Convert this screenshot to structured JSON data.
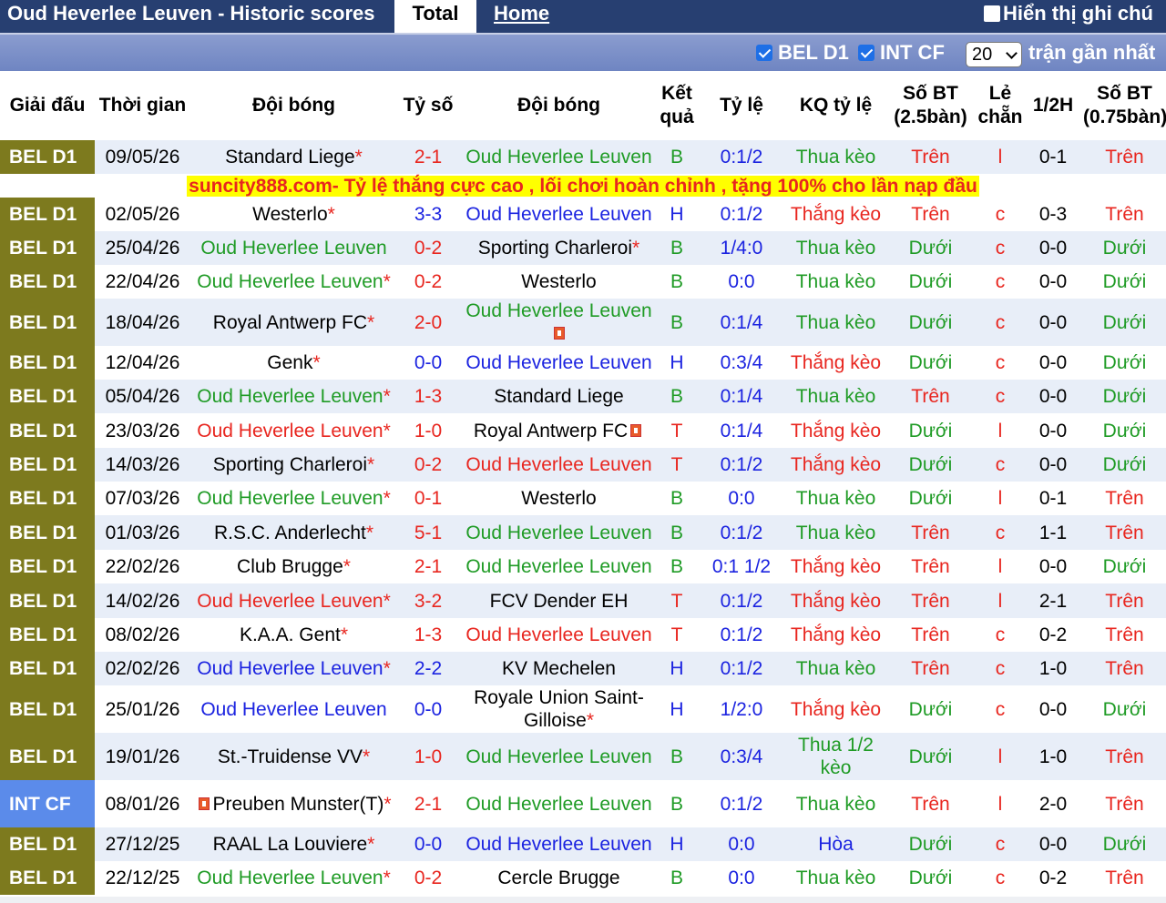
{
  "header": {
    "title": "Oud Heverlee Leuven - Historic scores",
    "tab_total": "Total",
    "tab_home": "Home",
    "notes_label": "Hiển thị ghi chú"
  },
  "filters": {
    "league1": "BEL D1",
    "league2": "INT CF",
    "count_value": "20",
    "count_suffix": "trận gần nhất"
  },
  "columns": [
    "Giải đấu",
    "Thời gian",
    "Đội bóng",
    "Tỷ số",
    "Đội bóng",
    "Kết quả",
    "Tỷ lệ",
    "KQ tỷ lệ",
    "Số BT (2.5bàn)",
    "Lẻ chẵn",
    "1/2H",
    "Số BT (0.75bàn)"
  ],
  "ad_text": "suncity888.com- Tỷ lệ thắng cực cao , lối chơi hoàn chỉnh , tặng 100% cho lần nạp đầu",
  "matches": [
    {
      "league": "BEL D1",
      "date": "09/05/26",
      "home": "Standard Liege",
      "home_star": "*",
      "score": "2-1",
      "away": "Oud Heverlee Leuven",
      "away_star": "",
      "result": "B",
      "odds": "0:1/2",
      "odds_result": "Thua kèo",
      "ou": "Trên",
      "oe": "l",
      "half": "0-1",
      "ou2": "Trên"
    },
    {
      "league": "BEL D1",
      "date": "02/05/26",
      "home": "Westerlo",
      "home_star": "*",
      "score": "3-3",
      "away": "Oud Heverlee Leuven",
      "away_star": "",
      "result": "H",
      "odds": "0:1/2",
      "odds_result": "Thắng kèo",
      "ou": "Trên",
      "oe": "c",
      "half": "0-3",
      "ou2": "Trên"
    },
    {
      "league": "BEL D1",
      "date": "25/04/26",
      "home": "Oud Heverlee Leuven",
      "home_star": "",
      "score": "0-2",
      "away": "Sporting Charleroi",
      "away_star": "*",
      "result": "B",
      "odds": "1/4:0",
      "odds_result": "Thua kèo",
      "ou": "Dưới",
      "oe": "c",
      "half": "0-0",
      "ou2": "Dưới"
    },
    {
      "league": "BEL D1",
      "date": "22/04/26",
      "home": "Oud Heverlee Leuven",
      "home_star": "*",
      "score": "0-2",
      "away": "Westerlo",
      "away_star": "",
      "result": "B",
      "odds": "0:0",
      "odds_result": "Thua kèo",
      "ou": "Dưới",
      "oe": "c",
      "half": "0-0",
      "ou2": "Dưới"
    },
    {
      "league": "BEL D1",
      "date": "18/04/26",
      "home": "Royal Antwerp FC",
      "home_star": "*",
      "score": "2-0",
      "away": "Oud Heverlee Leuven",
      "away_star": "",
      "result": "B",
      "odds": "0:1/4",
      "odds_result": "Thua kèo",
      "ou": "Dưới",
      "oe": "c",
      "half": "0-0",
      "ou2": "Dưới"
    },
    {
      "league": "BEL D1",
      "date": "12/04/26",
      "home": "Genk",
      "home_star": "*",
      "score": "0-0",
      "away": "Oud Heverlee Leuven",
      "away_star": "",
      "result": "H",
      "odds": "0:3/4",
      "odds_result": "Thắng kèo",
      "ou": "Dưới",
      "oe": "c",
      "half": "0-0",
      "ou2": "Dưới"
    },
    {
      "league": "BEL D1",
      "date": "05/04/26",
      "home": "Oud Heverlee Leuven",
      "home_star": "*",
      "score": "1-3",
      "away": "Standard Liege",
      "away_star": "",
      "result": "B",
      "odds": "0:1/4",
      "odds_result": "Thua kèo",
      "ou": "Trên",
      "oe": "c",
      "half": "0-0",
      "ou2": "Dưới"
    },
    {
      "league": "BEL D1",
      "date": "23/03/26",
      "home": "Oud Heverlee Leuven",
      "home_star": "*",
      "score": "1-0",
      "away": "Royal Antwerp FC",
      "away_star": "",
      "result": "T",
      "odds": "0:1/4",
      "odds_result": "Thắng kèo",
      "ou": "Dưới",
      "oe": "l",
      "half": "0-0",
      "ou2": "Dưới"
    },
    {
      "league": "BEL D1",
      "date": "14/03/26",
      "home": "Sporting Charleroi",
      "home_star": "*",
      "score": "0-2",
      "away": "Oud Heverlee Leuven",
      "away_star": "",
      "result": "T",
      "odds": "0:1/2",
      "odds_result": "Thắng kèo",
      "ou": "Dưới",
      "oe": "c",
      "half": "0-0",
      "ou2": "Dưới"
    },
    {
      "league": "BEL D1",
      "date": "07/03/26",
      "home": "Oud Heverlee Leuven",
      "home_star": "*",
      "score": "0-1",
      "away": "Westerlo",
      "away_star": "",
      "result": "B",
      "odds": "0:0",
      "odds_result": "Thua kèo",
      "ou": "Dưới",
      "oe": "l",
      "half": "0-1",
      "ou2": "Trên"
    },
    {
      "league": "BEL D1",
      "date": "01/03/26",
      "home": "R.S.C. Anderlecht",
      "home_star": "*",
      "score": "5-1",
      "away": "Oud Heverlee Leuven",
      "away_star": "",
      "result": "B",
      "odds": "0:1/2",
      "odds_result": "Thua kèo",
      "ou": "Trên",
      "oe": "c",
      "half": "1-1",
      "ou2": "Trên"
    },
    {
      "league": "BEL D1",
      "date": "22/02/26",
      "home": "Club Brugge",
      "home_star": "*",
      "score": "2-1",
      "away": "Oud Heverlee Leuven",
      "away_star": "",
      "result": "B",
      "odds": "0:1 1/2",
      "odds_result": "Thắng kèo",
      "ou": "Trên",
      "oe": "l",
      "half": "0-0",
      "ou2": "Dưới"
    },
    {
      "league": "BEL D1",
      "date": "14/02/26",
      "home": "Oud Heverlee Leuven",
      "home_star": "*",
      "score": "3-2",
      "away": "FCV Dender EH",
      "away_star": "",
      "result": "T",
      "odds": "0:1/2",
      "odds_result": "Thắng kèo",
      "ou": "Trên",
      "oe": "l",
      "half": "2-1",
      "ou2": "Trên"
    },
    {
      "league": "BEL D1",
      "date": "08/02/26",
      "home": "K.A.A. Gent",
      "home_star": "*",
      "score": "1-3",
      "away": "Oud Heverlee Leuven",
      "away_star": "",
      "result": "T",
      "odds": "0:1/2",
      "odds_result": "Thắng kèo",
      "ou": "Trên",
      "oe": "c",
      "half": "0-2",
      "ou2": "Trên"
    },
    {
      "league": "BEL D1",
      "date": "02/02/26",
      "home": "Oud Heverlee Leuven",
      "home_star": "*",
      "score": "2-2",
      "away": "KV Mechelen",
      "away_star": "",
      "result": "H",
      "odds": "0:1/2",
      "odds_result": "Thua kèo",
      "ou": "Trên",
      "oe": "c",
      "half": "1-0",
      "ou2": "Trên"
    },
    {
      "league": "BEL D1",
      "date": "25/01/26",
      "home": "Oud Heverlee Leuven",
      "home_star": "",
      "score": "0-0",
      "away": "Royale Union Saint-Gilloise",
      "away_star": "*",
      "result": "H",
      "odds": "1/2:0",
      "odds_result": "Thắng kèo",
      "ou": "Dưới",
      "oe": "c",
      "half": "0-0",
      "ou2": "Dưới"
    },
    {
      "league": "BEL D1",
      "date": "19/01/26",
      "home": "St.-Truidense VV",
      "home_star": "*",
      "score": "1-0",
      "away": "Oud Heverlee Leuven",
      "away_star": "",
      "result": "B",
      "odds": "0:3/4",
      "odds_result": "Thua 1/2 kèo",
      "ou": "Dưới",
      "oe": "l",
      "half": "1-0",
      "ou2": "Trên"
    },
    {
      "league": "INT CF",
      "date": "08/01/26",
      "home": "Preuben Munster(T)",
      "home_star": "*",
      "score": "2-1",
      "away": "Oud Heverlee Leuven",
      "away_star": "",
      "result": "B",
      "odds": "0:1/2",
      "odds_result": "Thua kèo",
      "ou": "Trên",
      "oe": "l",
      "half": "2-0",
      "ou2": "Trên"
    },
    {
      "league": "BEL D1",
      "date": "27/12/25",
      "home": "RAAL La Louviere",
      "home_star": "*",
      "score": "0-0",
      "away": "Oud Heverlee Leuven",
      "away_star": "",
      "result": "H",
      "odds": "0:0",
      "odds_result": "Hòa",
      "ou": "Dưới",
      "oe": "c",
      "half": "0-0",
      "ou2": "Dưới"
    },
    {
      "league": "BEL D1",
      "date": "22/12/25",
      "home": "Oud Heverlee Leuven",
      "home_star": "*",
      "score": "0-2",
      "away": "Cercle Brugge",
      "away_star": "",
      "result": "B",
      "odds": "0:0",
      "odds_result": "Thua kèo",
      "ou": "Dưới",
      "oe": "c",
      "half": "0-2",
      "ou2": "Trên"
    }
  ],
  "colors": {
    "header_bg": "#273f71",
    "league_bel": "#7d7a1e",
    "league_int": "#5b8bea",
    "win": "#e8261f",
    "loss": "#1f9b25",
    "draw": "#1b23e0",
    "ad_bg": "#ffff00"
  }
}
